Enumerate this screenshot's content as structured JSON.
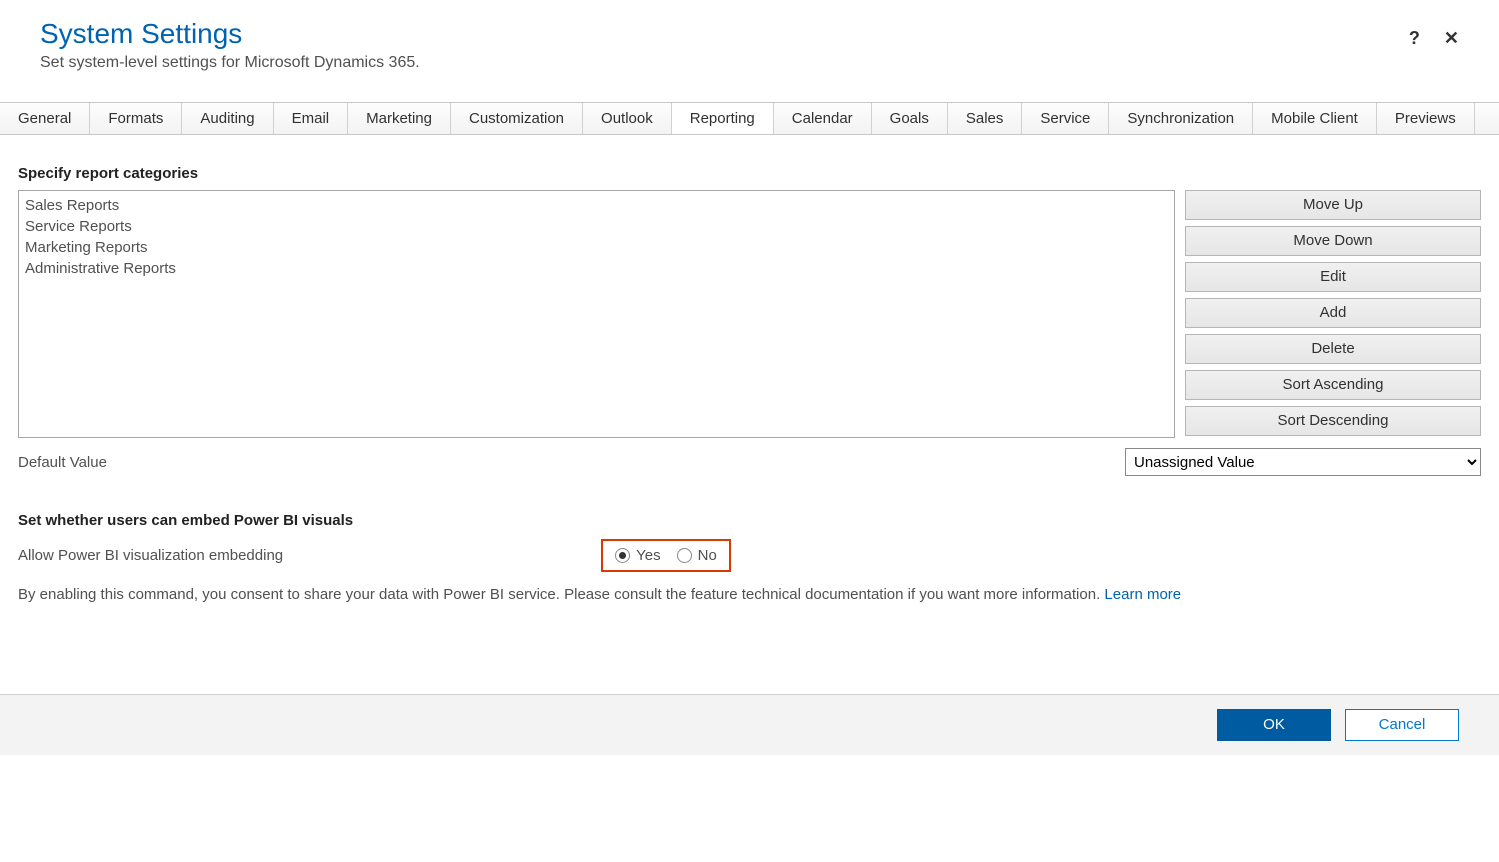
{
  "header": {
    "title": "System Settings",
    "subtitle": "Set system-level settings for Microsoft Dynamics 365.",
    "help": "?",
    "close": "✕"
  },
  "tabs": [
    {
      "label": "General"
    },
    {
      "label": "Formats"
    },
    {
      "label": "Auditing"
    },
    {
      "label": "Email"
    },
    {
      "label": "Marketing"
    },
    {
      "label": "Customization"
    },
    {
      "label": "Outlook"
    },
    {
      "label": "Reporting",
      "active": true
    },
    {
      "label": "Calendar"
    },
    {
      "label": "Goals"
    },
    {
      "label": "Sales"
    },
    {
      "label": "Service"
    },
    {
      "label": "Synchronization"
    },
    {
      "label": "Mobile Client"
    },
    {
      "label": "Previews"
    }
  ],
  "reportCategories": {
    "heading": "Specify report categories",
    "items": [
      "Sales Reports",
      "Service Reports",
      "Marketing Reports",
      "Administrative Reports"
    ],
    "buttons": {
      "moveUp": "Move Up",
      "moveDown": "Move Down",
      "edit": "Edit",
      "add": "Add",
      "delete": "Delete",
      "sortAsc": "Sort Ascending",
      "sortDesc": "Sort Descending"
    },
    "defaultLabel": "Default Value",
    "defaultSelected": "Unassigned Value"
  },
  "powerBi": {
    "heading": "Set whether users can embed Power BI visuals",
    "label": "Allow Power BI visualization embedding",
    "yes": "Yes",
    "no": "No",
    "selected": "yes",
    "disclaimer": "By enabling this command, you consent to share your data with Power BI service. Please consult the feature technical documentation if you want more information. ",
    "learnMore": "Learn more"
  },
  "footer": {
    "ok": "OK",
    "cancel": "Cancel"
  }
}
